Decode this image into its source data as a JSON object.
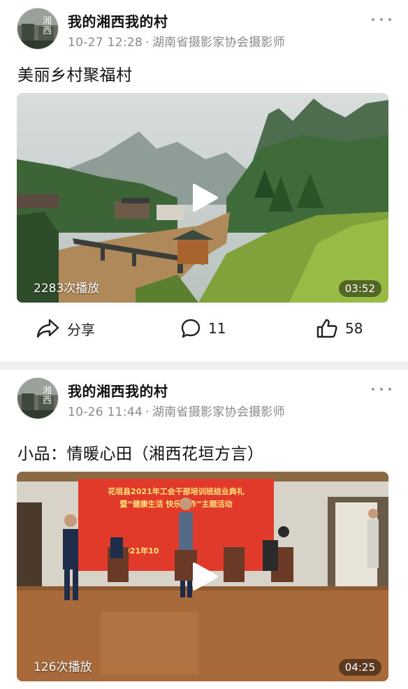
{
  "posts": [
    {
      "author": "我的湘西我的村",
      "time": "10-27 12:28",
      "source": "湖南省摄影家协会摄影师",
      "title": "美丽乡村聚福村",
      "video": {
        "plays": "2283次播放",
        "duration": "03:52"
      },
      "actions": {
        "share": "分享",
        "comments": "11",
        "likes": "58"
      }
    },
    {
      "author": "我的湘西我的村",
      "time": "10-26 11:44",
      "source": "湖南省摄影家协会摄影师",
      "title": "小品：情暖心田（湘西花垣方言）",
      "video": {
        "plays": "126次播放",
        "duration": "04:25",
        "banner_line1": "花垣县2021年工会干部培训班结业典礼",
        "banner_line2": "暨“健康生活 快乐工作”主题活动",
        "banner_line3": "2021年10"
      }
    }
  ],
  "icons": [
    "more-icon",
    "play-icon",
    "share-icon",
    "comment-icon",
    "like-icon"
  ],
  "colors": {
    "meta_gray": "#8a8a8a",
    "banner_red": "#e23a2a",
    "banner_text": "#ffe07a"
  }
}
